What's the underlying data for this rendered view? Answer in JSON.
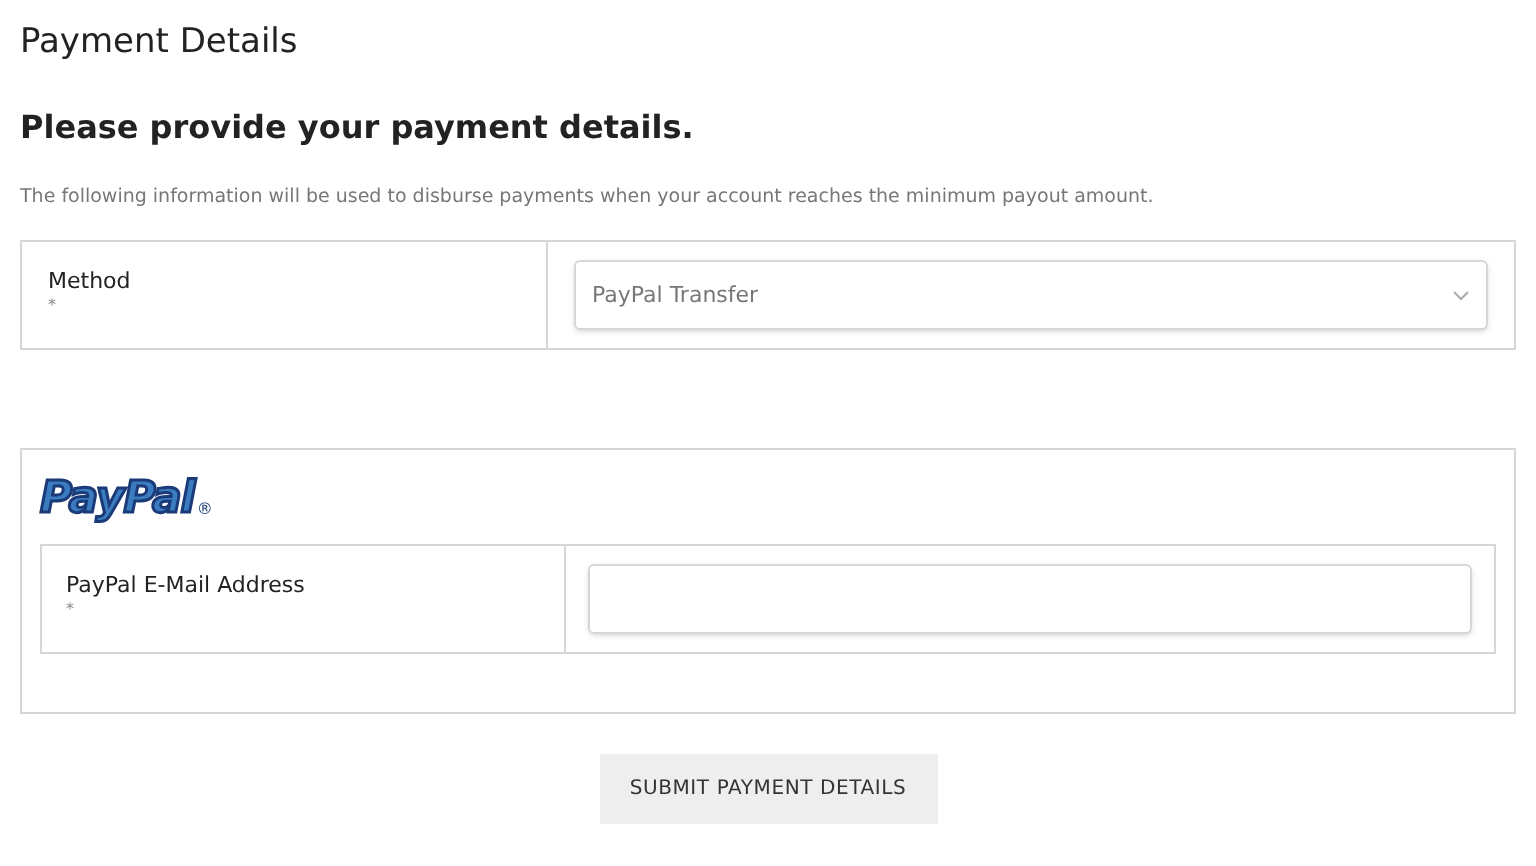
{
  "title": "Payment Details",
  "subtitle": "Please provide your payment details.",
  "intro": "The following information will be used to disburse payments when your account reaches the minimum payout amount.",
  "method": {
    "label": "Method",
    "required_mark": "*",
    "value": "PayPal Transfer"
  },
  "paypal": {
    "logo": "PayPal",
    "logo_mark": "®",
    "field": {
      "label": "PayPal E-Mail Address",
      "required_mark": "*"
    }
  },
  "submit": "SUBMIT PAYMENT DETAILS"
}
